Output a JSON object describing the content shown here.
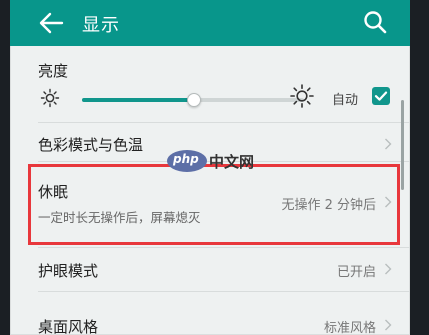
{
  "header": {
    "title": "显示"
  },
  "brightness": {
    "title": "亮度",
    "level": 0.5,
    "auto_label": "自动",
    "auto_checked": true
  },
  "items": [
    {
      "label": "色彩模式与色温"
    },
    {
      "label": "休眠",
      "sub": "一定时长无操作后，屏幕熄灭",
      "value": "无操作 2 分钟后"
    },
    {
      "label": "护眼模式",
      "value": "已开启"
    },
    {
      "label": "桌面风格",
      "value": "标准风格"
    }
  ],
  "watermark": {
    "badge": "php",
    "text": "中文网"
  },
  "colors": {
    "accent": "#08968b",
    "highlight": "#e8373c",
    "background": "#eef1f1"
  },
  "icons": [
    "back-arrow-icon",
    "search-icon",
    "sun-small-icon",
    "sun-large-icon",
    "checkbox-check-icon",
    "chevron-right-icon"
  ]
}
